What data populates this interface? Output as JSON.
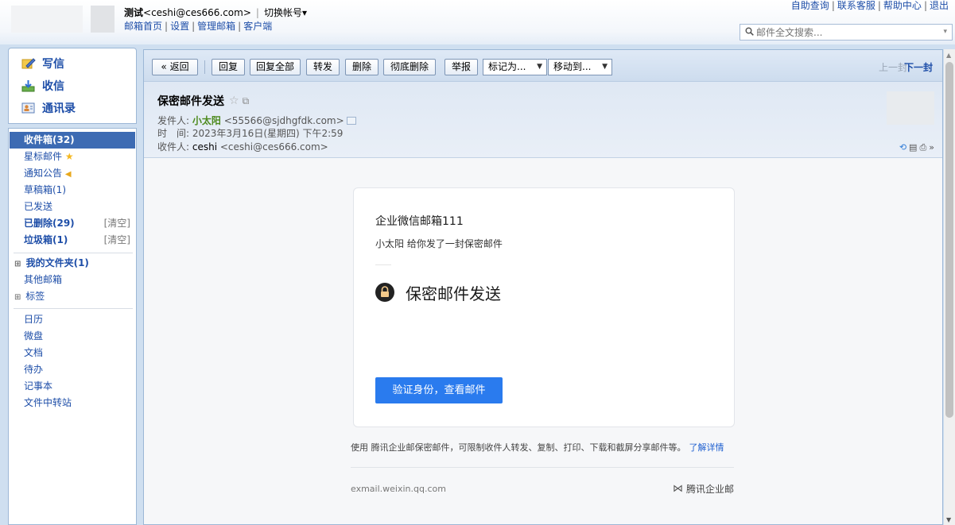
{
  "header": {
    "account_name": "测试",
    "account_email": "<ceshi@ces666.com>",
    "separator": "|",
    "switch_account": "切换帐号",
    "switch_caret": "▾",
    "links": [
      "邮箱首页",
      "设置",
      "管理邮箱",
      "客户端"
    ],
    "link_sep": "|",
    "top_links": [
      "自助查询",
      "联系客服",
      "帮助中心",
      "退出"
    ],
    "search_placeholder": "邮件全文搜索...",
    "search_caret": "▾"
  },
  "sidebar": {
    "quick": [
      {
        "label": "写信",
        "icon": "compose-icon"
      },
      {
        "label": "收信",
        "icon": "inbox-download-icon"
      },
      {
        "label": "通讯录",
        "icon": "contacts-icon"
      }
    ],
    "folders": [
      {
        "label": "收件箱(32)"
      },
      {
        "label": "星标邮件",
        "suffix": "★"
      },
      {
        "label": "通知公告",
        "suffix": "◀"
      },
      {
        "label": "草稿箱(1)"
      },
      {
        "label": "已发送"
      },
      {
        "label": "已删除(29)",
        "clear": "[清空]"
      },
      {
        "label": "垃圾箱(1)",
        "clear": "[清空]"
      },
      {
        "label": "我的文件夹(1)",
        "prefix": "⊞"
      },
      {
        "label": "其他邮箱"
      },
      {
        "label": "标签",
        "prefix": "⊞"
      },
      {
        "label": "日历"
      },
      {
        "label": "微盘"
      },
      {
        "label": "文档"
      },
      {
        "label": "待办"
      },
      {
        "label": "记事本"
      },
      {
        "label": "文件中转站"
      }
    ]
  },
  "toolbar": {
    "back": "« 返回",
    "reply": "回复",
    "reply_all": "回复全部",
    "forward": "转发",
    "delete": "删除",
    "delete_perm": "彻底删除",
    "report": "举报",
    "mark_as": "标记为...",
    "move_to": "移动到...",
    "dropdown_caret": "▼",
    "prev": "上一封",
    "next": "下一封"
  },
  "mail": {
    "subject": "保密邮件发送",
    "star": "☆",
    "window_icon": "⧉",
    "from_label": "发件人:",
    "from_name": "小太阳",
    "from_addr": "<55566@sjdhgfdk.com>",
    "time_label": "时　间:",
    "time_value": "2023年3月16日(星期四) 下午2:59",
    "to_label": "收件人:",
    "to_name": "ceshi",
    "to_addr": "<ceshi@ces666.com>",
    "header_icons": [
      "⟲",
      "▤",
      "⎙",
      "»"
    ]
  },
  "card": {
    "title": "企业微信邮箱111",
    "subtitle": "小太阳 给你发了一封保密邮件",
    "big_title": "保密邮件发送",
    "verify_button": "验证身份，查看邮件",
    "note": "使用 腾讯企业邮保密邮件，可限制收件人转发、复制、打印、下载和截屏分享邮件等。",
    "learn_more": "了解详情",
    "footer_left": "exmail.weixin.qq.com",
    "footer_logo": "⋈",
    "footer_right": "腾讯企业邮"
  },
  "scrollbar": {
    "up": "▲",
    "down": "▼"
  },
  "colors": {
    "link_blue": "#1e4ea8",
    "active_folder": "#3d6bb3",
    "sender_green": "#4d8a1d",
    "verify_button": "#2a7bee",
    "star_yellow": "#f5b820",
    "notice_yellow": "#e8a81c"
  }
}
